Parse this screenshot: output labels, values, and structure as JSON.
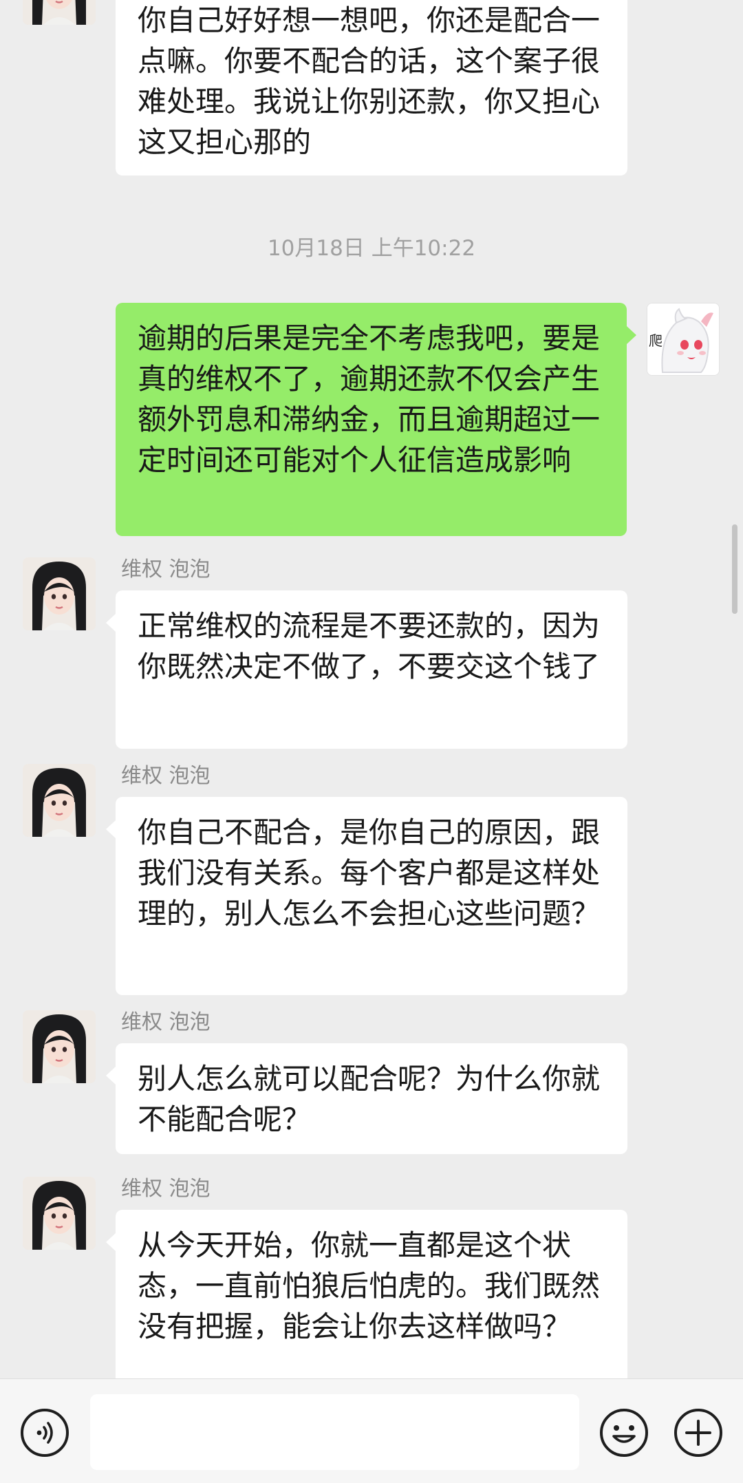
{
  "messages": [
    {
      "text": "你自己好好想一想吧，你还是配合一点嘛。你要不配合的话，这个案子很难处理。我说让你别还款，你又担心这又担心那的"
    },
    {
      "timestamp": "10月18日 上午10:22"
    },
    {
      "text": "逾期的后果是完全不考虑我吧，要是真的维权不了，逾期还款不仅会产生额外罚息和滞纳金，而且逾期超过一定时间还可能对个人征信造成影响",
      "avatar_caption": "爬"
    },
    {
      "sender": "维权 泡泡",
      "text": "正常维权的流程是不要还款的，因为你既然决定不做了，不要交这个钱了"
    },
    {
      "sender": "维权 泡泡",
      "text": "你自己不配合，是你自己的原因，跟我们没有关系。每个客户都是这样处理的，别人怎么不会担心这些问题？"
    },
    {
      "sender": "维权 泡泡",
      "text": "别人怎么就可以配合呢？为什么你就不能配合呢？"
    },
    {
      "sender": "维权 泡泡",
      "text": "从今天开始，你就一直都是这个状态，一直前怕狼后怕虎的。我们既然没有把握，能会让你去这样做吗？"
    }
  ],
  "input_bar": {
    "voice_icon": "voice-icon",
    "emoji_icon": "emoji-icon",
    "plus_icon": "plus-icon",
    "input_value": ""
  },
  "colors": {
    "background": "#ededed",
    "self_bubble": "#95ec69",
    "other_bubble": "#ffffff"
  }
}
